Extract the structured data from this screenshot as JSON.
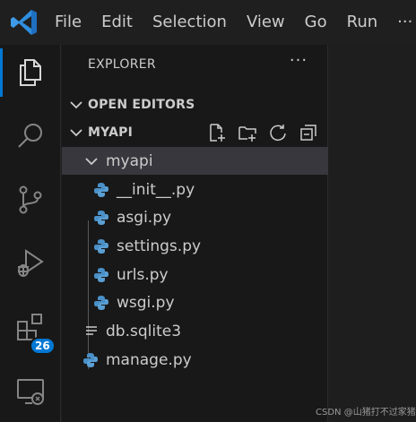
{
  "menu": [
    "File",
    "Edit",
    "Selection",
    "View",
    "Go",
    "Run",
    "···"
  ],
  "activity": {
    "extensions_badge": "26"
  },
  "explorer": {
    "title": "EXPLORER",
    "more": "···",
    "open_editors": "OPEN EDITORS",
    "project": "MYAPI",
    "folder": "myapi",
    "files": [
      "__init__.py",
      "asgi.py",
      "settings.py",
      "urls.py",
      "wsgi.py"
    ],
    "db_file": "db.sqlite3",
    "manage_file": "manage.py"
  },
  "watermark": "CSDN @山猪打不过家猪",
  "colors": {
    "accent": "#0078d4",
    "python_icon": "#4a90c8",
    "selection": "#37373d"
  }
}
